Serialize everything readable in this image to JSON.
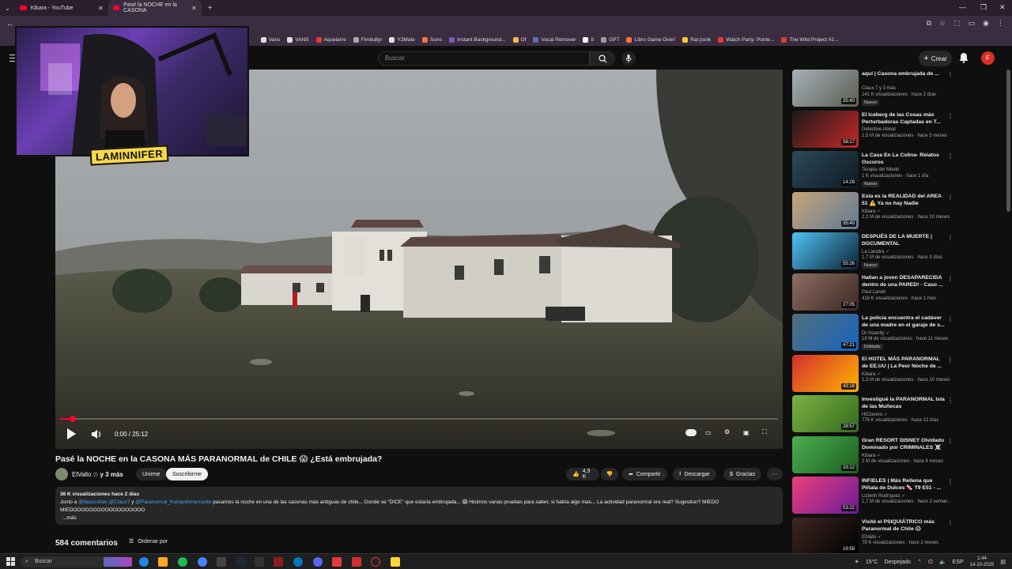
{
  "browser": {
    "tabs": [
      {
        "label": "Kibara - YouTube",
        "active": false
      },
      {
        "label": "Pasé la NOCHE en la CASONA",
        "active": true
      }
    ],
    "new_tab": "+",
    "bookmarks": [
      {
        "label": "Vans",
        "color": "#dddddd"
      },
      {
        "label": "VANS",
        "color": "#dddddd"
      },
      {
        "label": "Aquelarre",
        "color": "#e53935"
      },
      {
        "label": "Fimbultyr",
        "color": "#aaaaaa"
      },
      {
        "label": "Y2Mate",
        "color": "#e0e0e0"
      },
      {
        "label": "Suno",
        "color": "#ff7043"
      },
      {
        "label": "Instant Background...",
        "color": "#7e57c2"
      },
      {
        "label": "Of",
        "color": "#ffb74d"
      },
      {
        "label": "Vocal Remover",
        "color": "#5c6bc0"
      },
      {
        "label": "tt",
        "color": "#ffffff"
      },
      {
        "label": "GPT",
        "color": "#9e9e9e"
      },
      {
        "label": "Libro Game Over!",
        "color": "#ff7043"
      },
      {
        "label": "Rat punk",
        "color": "#ffca28"
      },
      {
        "label": "Watch Party: Ponte...",
        "color": "#e53935"
      },
      {
        "label": "The Wild Project #2...",
        "color": "#e53935"
      }
    ]
  },
  "header": {
    "search_placeholder": "Buscar",
    "create_label": "Crear",
    "avatar_letter": "F"
  },
  "stream_overlay": {
    "name": "LAMINNIFER"
  },
  "player": {
    "time": "0:00 / 25:12",
    "progress_fraction": 0.005
  },
  "video": {
    "title": "Pasé la NOCHE en la CASONA MÁS PARANORMAL de CHILE 😱 ¿Está embrujada?",
    "channel": "ElVallo",
    "collab": "y 3 más",
    "join_label": "Unirme",
    "subscribe_label": "Suscribirme",
    "likes": "4,9 K",
    "share_label": "Compartir",
    "download_label": "Descargar",
    "thanks_label": "Gracias",
    "description": {
      "stats": "36 K visualizaciones  hace 2 días",
      "prefix": "Junto a ",
      "mention1": "@Ibascuñan",
      "mention2": "@Claux7",
      "and": " y ",
      "mention3": "@Paranormal_franquitomercante",
      "body": " pasamos la noche en una de las casonas mas antiguas de chile... Donde se \"DICE\" que estaría embrujada... 😱 Hicimos varias pruebas para saber, si había algo mas... La actividad paranormal era real? Sugestion? MIEDO",
      "line2": "MIEDOOOOOOOOOOOOOOOOOO",
      "more": "...más"
    },
    "comments_count": "584 comentarios",
    "sort_label": "Ordenar por"
  },
  "recommendations": [
    {
      "title": "aquí | Casona embrujada de ...",
      "channel": "Claux 7 y 3 más",
      "meta": "141 K visualizaciones · hace 2 días",
      "duration": "35:40",
      "badge": "Nuevo",
      "colors": [
        "#a8b0b8",
        "#5a5e52"
      ]
    },
    {
      "title": "El Iceberg de las Cosas más Perturbadoras Captadas en T...",
      "channel": "Detective Abisal",
      "meta": "1,5 M de visualizaciones · hace 5 meses",
      "duration": "58:17",
      "badge": "",
      "colors": [
        "#1a1a1a",
        "#c62828"
      ]
    },
    {
      "title": "La Casa En La Colina- Relatos Oscuros",
      "channel": "Terapia del Miedo",
      "meta": "1 K visualizaciones · hace 1 día",
      "duration": "14:29",
      "badge": "Nuevo",
      "colors": [
        "#2d4a5a",
        "#0d1a22"
      ]
    },
    {
      "title": "Esta es la REALIDAD del AREA 51 ⚠️ Ya no hay Nadie",
      "channel": "Kibara ✓",
      "meta": "2,2 M de visualizaciones · hace 10 meses",
      "duration": "35:40",
      "badge": "",
      "colors": [
        "#c9a57a",
        "#5d7a96"
      ]
    },
    {
      "title": "DESPUÉS DE LA MUERTE | DOCUMENTAL",
      "channel": "La Liendra ✓",
      "meta": "1,7 M de visualizaciones · hace 3 días",
      "duration": "55:26",
      "badge": "Nuevo",
      "colors": [
        "#4fc3f7",
        "#0d2233"
      ]
    },
    {
      "title": "Hallan a joven DESAPARECIDA dentro de una PARED! - Caso ...",
      "channel": "Paul Landó",
      "meta": "416 K visualizaciones · hace 1 mes",
      "duration": "27:05",
      "badge": "",
      "colors": [
        "#8d6e63",
        "#3e2723"
      ]
    },
    {
      "title": "La policía encuentra el cadáver de una madre en el garaje de s...",
      "channel": "Dr Insanity ✓",
      "meta": "19 M de visualizaciones · hace 11 meses",
      "duration": "47:21",
      "badge": "Doblado",
      "colors": [
        "#546e7a",
        "#1565c0"
      ]
    },
    {
      "title": "El HOTEL MÁS PARANORMAL de EE.UU | La Peor Noche de ...",
      "channel": "Kibara ✓",
      "meta": "1,3 M de visualizaciones · hace 10 meses",
      "duration": "43:18",
      "badge": "",
      "colors": [
        "#d32f2f",
        "#ffb300"
      ]
    },
    {
      "title": "Investigué la PARANORMAL Isla de las Muñecas",
      "channel": "HiClavero ✓",
      "meta": "776 K visualizaciones · hace 12 días",
      "duration": "28:57",
      "badge": "",
      "colors": [
        "#7cb342",
        "#33691e"
      ]
    },
    {
      "title": "Gran RESORT DISNEY Olvidado Dominado por CRIMINALES ☠️",
      "channel": "Kibara ✓",
      "meta": "2 M de visualizaciones · hace 4 meses",
      "duration": "33:12",
      "badge": "",
      "colors": [
        "#4caf50",
        "#1b5e20"
      ]
    },
    {
      "title": "INFIELES | Más Rellena que Piñata de Dulces 🍬 T9 E51 - ...",
      "channel": "Lizbeth Rodríguez ✓",
      "meta": "1,7 M de visualizaciones · hace 2 seman...",
      "duration": "53:22",
      "badge": "",
      "colors": [
        "#ec407a",
        "#6a1b9a"
      ]
    },
    {
      "title": "Visité el PSIQUIÁTRICO más Paranormal de Chile 😱",
      "channel": "ElVallo ✓",
      "meta": "79 K visualizaciones · hace 2 meses",
      "duration": "19:59",
      "badge": "",
      "colors": [
        "#3e2723",
        "#000000"
      ]
    }
  ],
  "taskbar": {
    "search_placeholder": "Buscar",
    "weather": "15°C",
    "weather_desc": "Despejado",
    "lang": "ESP",
    "time": "1:44",
    "date": "14-10-2025"
  }
}
